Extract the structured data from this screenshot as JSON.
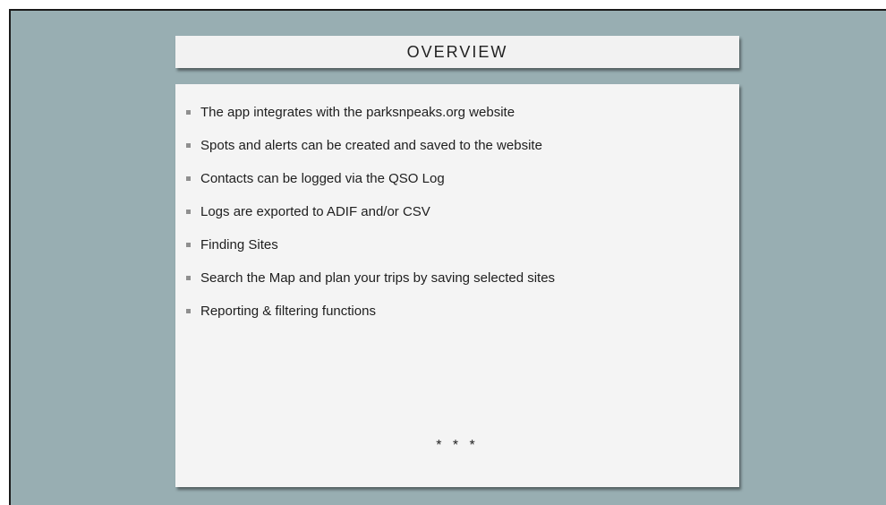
{
  "slide": {
    "title": "OVERVIEW",
    "bullets": [
      "The app integrates with the parksnpeaks.org website",
      "Spots and alerts can be created and saved to the website",
      "Contacts can be logged via the QSO Log",
      "Logs are exported to ADIF and/or CSV",
      "Finding Sites",
      "Search the Map and plan your trips by saving selected sites",
      "Reporting & filtering functions"
    ],
    "footer_mark": "* * *"
  }
}
